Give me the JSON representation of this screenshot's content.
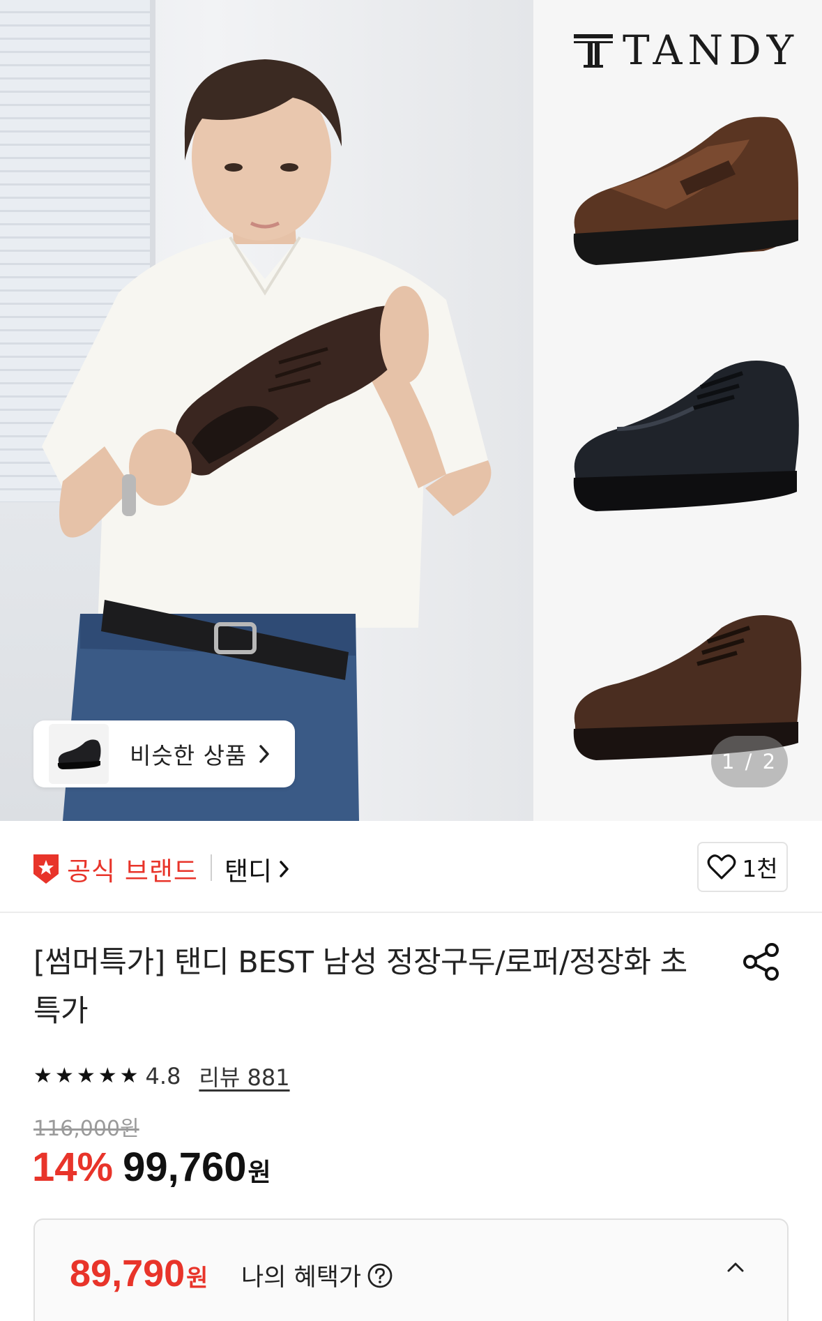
{
  "hero": {
    "brand_logo_text": "TANDY",
    "similar_products_label": "비슷한 상품",
    "pager": "1 / 2"
  },
  "brand": {
    "official_label": "공식 브랜드",
    "brand_name": "탠디",
    "like_count": "1천"
  },
  "product": {
    "title": "[썸머특가] 탠디 BEST 남성 정장구두/로퍼/정장화 초특가",
    "rating": "4.8",
    "reviews_label": "리뷰 881",
    "original_price": "116,000원",
    "discount": "14%",
    "price": "99,760",
    "price_unit": "원"
  },
  "benefit": {
    "price": "89,790",
    "unit": "원",
    "label": "나의 혜택가"
  },
  "colors": {
    "accent_red": "#e8342a",
    "text": "#111111"
  }
}
